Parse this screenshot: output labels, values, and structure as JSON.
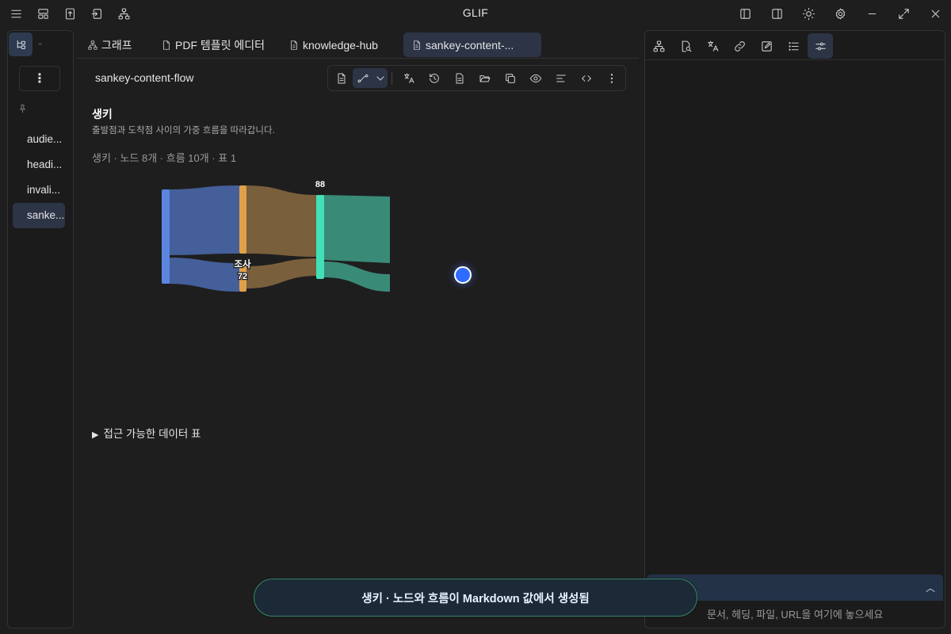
{
  "app": {
    "title": "GLIF"
  },
  "left_sidebar": {
    "menu_label": "⋮",
    "files": [
      {
        "label": "audie..."
      },
      {
        "label": "headi..."
      },
      {
        "label": "invali..."
      },
      {
        "label": "sanke..."
      }
    ]
  },
  "tabs": [
    {
      "label": "그래프",
      "icon": "graph-icon"
    },
    {
      "label": "PDF 템플릿 에디터",
      "icon": "file-icon"
    },
    {
      "label": "knowledge-hub",
      "icon": "file-icon"
    },
    {
      "label": "sankey-content-...",
      "icon": "file-icon"
    }
  ],
  "document": {
    "title": "sankey-content-flow",
    "heading": "생키",
    "description": "출발점과 도착점 사이의 가중 흐름을 따라갑니다.",
    "meta": "생키 · 노드 8개 · 흐름 10개 · 표 1",
    "data_table_toggle": "접근 가능한 데이터 표"
  },
  "chart_data": {
    "type": "sankey",
    "node_labels": [
      {
        "text": "88"
      },
      {
        "text": "조사"
      },
      {
        "text": "72"
      }
    ],
    "colors": {
      "node_blue": "#5b86e0",
      "node_orange": "#e0a04a",
      "node_teal": "#42e0b8",
      "flow_blue": "#445f99",
      "flow_brown": "#7a5f3c",
      "flow_teal": "#3a8a78"
    }
  },
  "right_panel": {
    "composer_count": "0",
    "drop_hint": "문서, 헤딩, 파일, URL을 여기에 놓으세요"
  },
  "toast": {
    "message": "생키 · 노드와 흐름이 Markdown 값에서 생성됨"
  }
}
